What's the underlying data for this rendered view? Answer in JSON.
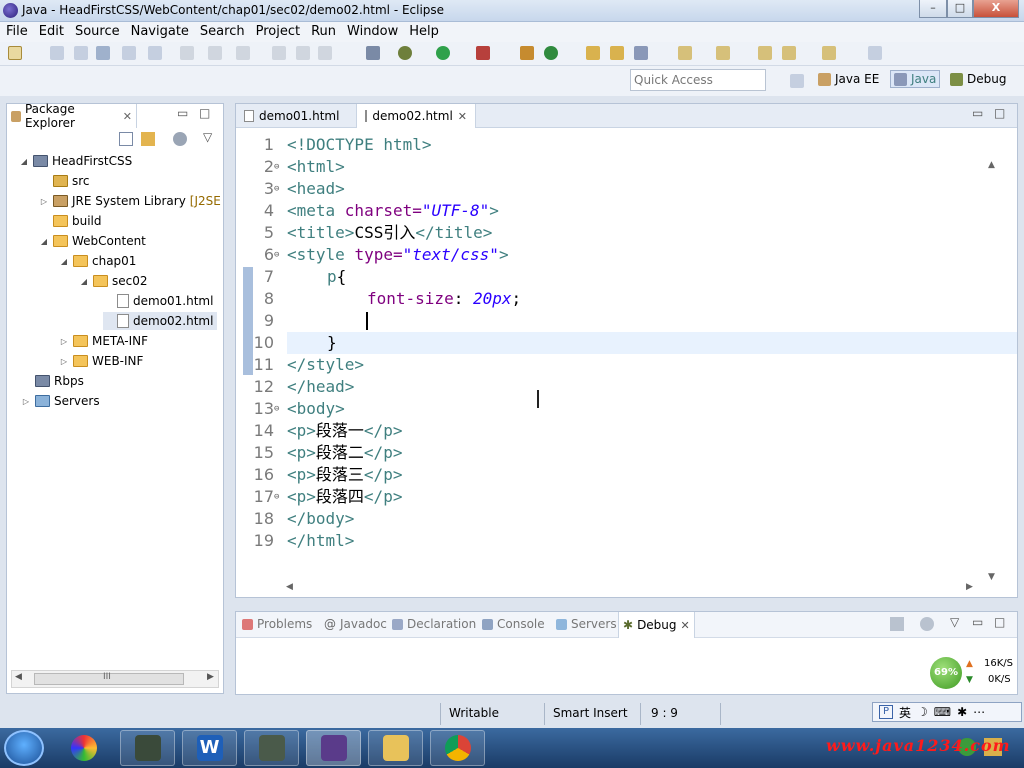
{
  "window": {
    "title": "Java - HeadFirstCSS/WebContent/chap01/sec02/demo02.html - Eclipse",
    "minimize": "–",
    "maximize": "□",
    "close": "X"
  },
  "menu": [
    "File",
    "Edit",
    "Source",
    "Navigate",
    "Search",
    "Project",
    "Run",
    "Window",
    "Help"
  ],
  "toolbar": {
    "quick_access_placeholder": "Quick Access",
    "perspectives": [
      {
        "label": "Java EE",
        "icon": "java-ee-perspective-icon"
      },
      {
        "label": "Java",
        "icon": "java-perspective-icon",
        "selected": true
      },
      {
        "label": "Debug",
        "icon": "debug-perspective-icon"
      }
    ]
  },
  "package_explorer": {
    "title": "Package Explorer",
    "tree": [
      {
        "label": "HeadFirstCSS",
        "icon": "project-icon",
        "level": 0,
        "expanded": true
      },
      {
        "label": "src",
        "icon": "package-folder-icon",
        "level": 1
      },
      {
        "label": "JRE System Library",
        "suffix": "[J2SE",
        "icon": "library-icon",
        "level": 1,
        "expandable": true
      },
      {
        "label": "build",
        "icon": "folder-icon",
        "level": 1
      },
      {
        "label": "WebContent",
        "icon": "folder-icon",
        "level": 1,
        "expanded": true
      },
      {
        "label": "chap01",
        "icon": "folder-icon",
        "level": 2,
        "expanded": true
      },
      {
        "label": "sec02",
        "icon": "folder-icon",
        "level": 3,
        "expanded": true
      },
      {
        "label": "demo01.html",
        "icon": "html-file-icon",
        "level": 4
      },
      {
        "label": "demo02.html",
        "icon": "html-file-icon",
        "level": 4,
        "selected": true
      },
      {
        "label": "META-INF",
        "icon": "folder-icon",
        "level": 2,
        "expandable": true
      },
      {
        "label": "WEB-INF",
        "icon": "folder-icon",
        "level": 2,
        "expandable": true
      },
      {
        "label": "Rbps",
        "icon": "project-icon",
        "level": 0
      },
      {
        "label": "Servers",
        "icon": "server-folder-icon",
        "level": 0,
        "expandable": true
      }
    ],
    "scroll_thumb": "III"
  },
  "editor": {
    "tabs": [
      {
        "label": "demo01.html",
        "active": false
      },
      {
        "label": "demo02.html",
        "active": true
      }
    ],
    "lines": [
      {
        "n": "1",
        "fold": ""
      },
      {
        "n": "2",
        "fold": "⊖"
      },
      {
        "n": "3",
        "fold": "⊖"
      },
      {
        "n": "4",
        "fold": ""
      },
      {
        "n": "5",
        "fold": ""
      },
      {
        "n": "6",
        "fold": "⊖"
      },
      {
        "n": "7",
        "fold": ""
      },
      {
        "n": "8",
        "fold": ""
      },
      {
        "n": "9",
        "fold": ""
      },
      {
        "n": "10",
        "fold": ""
      },
      {
        "n": "11",
        "fold": ""
      },
      {
        "n": "12",
        "fold": ""
      },
      {
        "n": "13",
        "fold": "⊖"
      },
      {
        "n": "14",
        "fold": ""
      },
      {
        "n": "15",
        "fold": ""
      },
      {
        "n": "16",
        "fold": ""
      },
      {
        "n": "17",
        "fold": "⊖"
      },
      {
        "n": "18",
        "fold": ""
      },
      {
        "n": "19",
        "fold": ""
      }
    ],
    "code": {
      "l1": "<!DOCTYPE html>",
      "l2": "<html>",
      "l3": "<head>",
      "l4_tag": "<meta ",
      "l4_attr": "charset=",
      "l4_val": "\"UTF-8\"",
      "l4_close": ">",
      "l5_open": "<title>",
      "l5_text": "CSS引入",
      "l5_close": "</title>",
      "l6_tag": "<style ",
      "l6_attr": "type=",
      "l6_val": "\"text/css\"",
      "l6_close": ">",
      "l7_sel": "p",
      "l7_brace": "{",
      "l8_prop": "font-size",
      "l8_colon": ": ",
      "l8_val": "20px",
      "l8_semi": ";",
      "l10_brace": "}",
      "l11": "</style>",
      "l12": "</head>",
      "l13": "<body>",
      "p_open": "<p>",
      "p_close": "</p>",
      "l14": "段落一",
      "l15": "段落二",
      "l16": "段落三",
      "l17": "段落四",
      "l18": "</body>",
      "l19": "</html>"
    }
  },
  "views": {
    "tabs": [
      {
        "label": "Problems",
        "icon": "problems-icon"
      },
      {
        "label": "Javadoc",
        "icon": "javadoc-icon"
      },
      {
        "label": "Declaration",
        "icon": "declaration-icon"
      },
      {
        "label": "Console",
        "icon": "console-icon"
      },
      {
        "label": "Servers",
        "icon": "servers-icon"
      },
      {
        "label": "Debug",
        "icon": "debug-icon",
        "active": true
      }
    ]
  },
  "network": {
    "percent": "69%",
    "up": "16K/S",
    "down": "0K/S"
  },
  "status": {
    "writable": "Writable",
    "insert_mode": "Smart Insert",
    "position": "9 : 9",
    "ime": [
      "英",
      "☽",
      "⌨",
      "✱",
      "⋯"
    ]
  },
  "taskbar": {
    "watermark": "www.java1234.com"
  }
}
